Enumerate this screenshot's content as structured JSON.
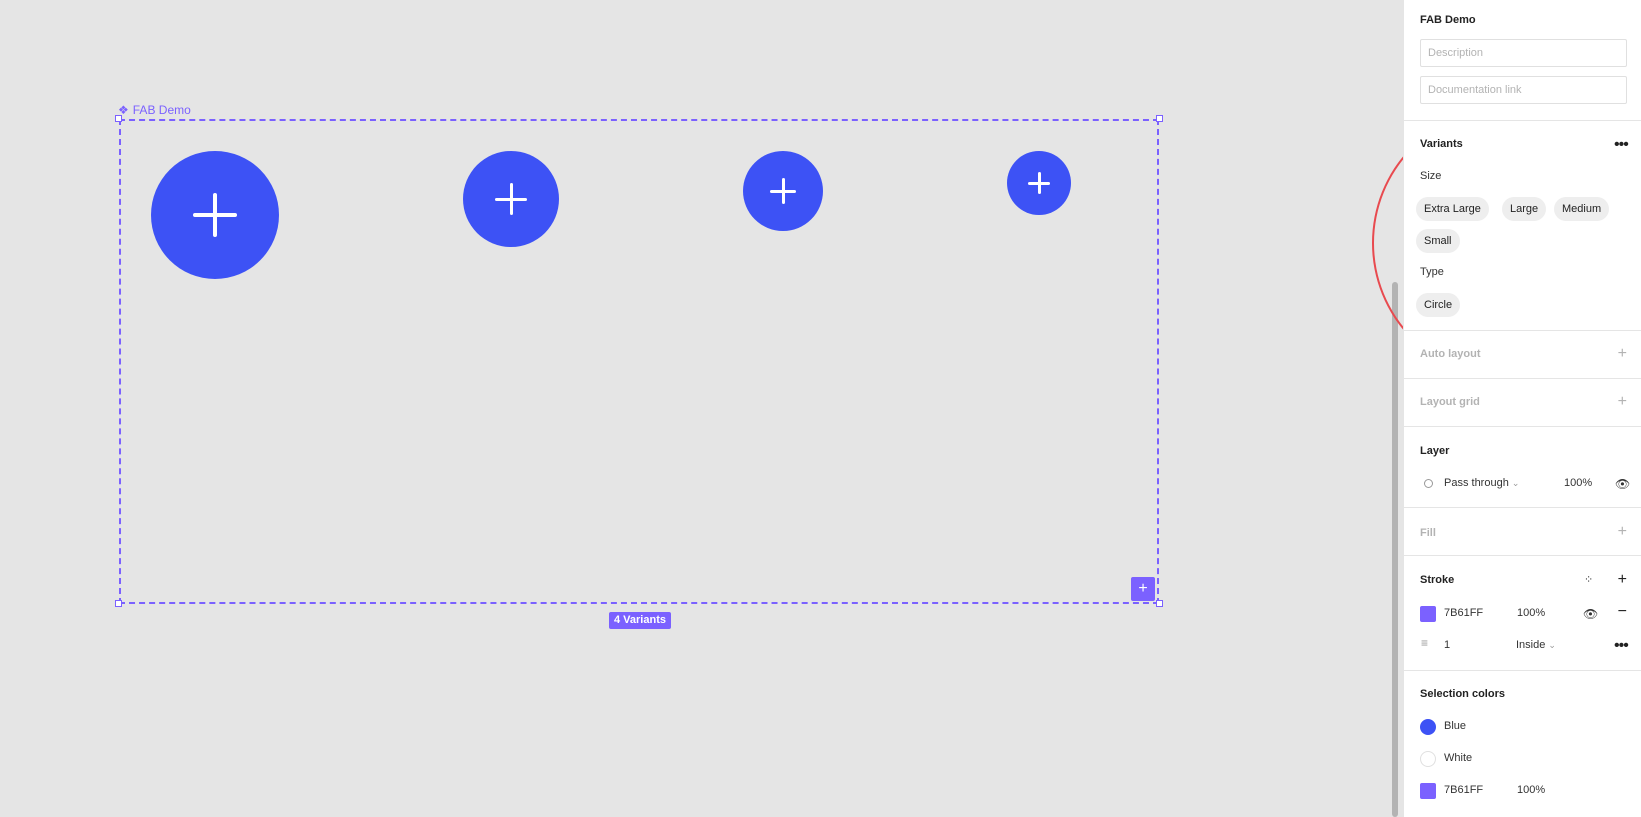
{
  "canvas": {
    "component_label": "FAB Demo",
    "component_icon": "component-diamond-icon",
    "variants_badge": "4 Variants",
    "add_variant_icon": "plus-icon",
    "fabs": [
      {
        "name": "Extra Large",
        "icon": "plus-icon"
      },
      {
        "name": "Large",
        "icon": "plus-icon"
      },
      {
        "name": "Medium",
        "icon": "plus-icon"
      },
      {
        "name": "Small",
        "icon": "plus-icon"
      }
    ],
    "colors": {
      "frame": "#7B61FF",
      "fab": "#3D52F5"
    }
  },
  "panel": {
    "title": "FAB Demo",
    "description_placeholder": "Description",
    "doc_link_placeholder": "Documentation link",
    "variants": {
      "title": "Variants",
      "size_label": "Size",
      "size_options": [
        "Extra Large",
        "Large",
        "Medium",
        "Small"
      ],
      "type_label": "Type",
      "type_options": [
        "Circle"
      ]
    },
    "auto_layout": {
      "title": "Auto layout"
    },
    "layout_grid": {
      "title": "Layout grid"
    },
    "layer": {
      "title": "Layer",
      "blend_mode": "Pass through",
      "opacity": "100%"
    },
    "fill": {
      "title": "Fill"
    },
    "stroke": {
      "title": "Stroke",
      "color": "7B61FF",
      "opacity": "100%",
      "weight": "1",
      "position": "Inside"
    },
    "selection_colors": {
      "title": "Selection colors",
      "items": [
        {
          "name": "Blue",
          "hex": "#3D52F5"
        },
        {
          "name": "White",
          "hex": "#FFFFFF"
        },
        {
          "name": "7B61FF",
          "hex": "#7B61FF",
          "opacity": "100%"
        }
      ]
    }
  }
}
